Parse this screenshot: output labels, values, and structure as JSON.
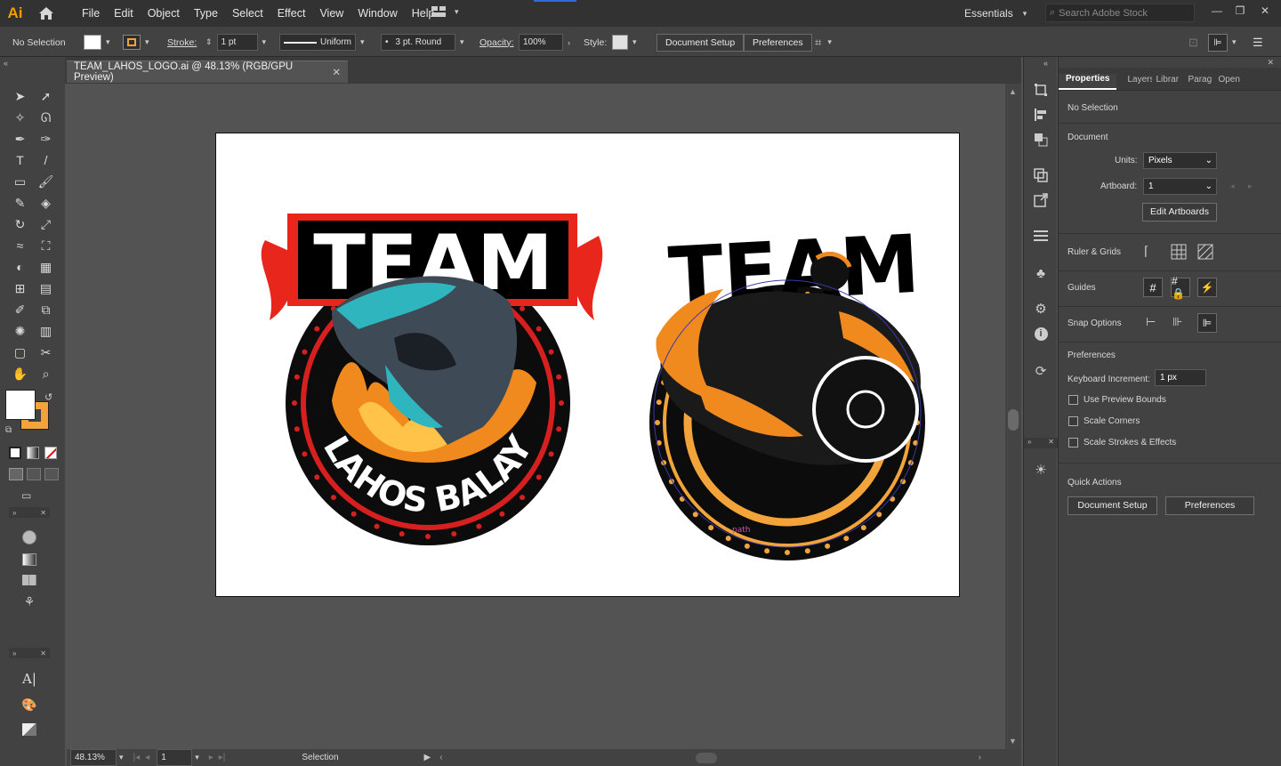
{
  "app": {
    "logo": "Ai",
    "menus": [
      "File",
      "Edit",
      "Object",
      "Type",
      "Select",
      "Effect",
      "View",
      "Window",
      "Help"
    ],
    "workspace": "Essentials",
    "search_placeholder": "Search Adobe Stock"
  },
  "control": {
    "selection": "No Selection",
    "stroke_label": "Stroke:",
    "stroke_weight": "1 pt",
    "profile": "Uniform",
    "brush": "3 pt. Round",
    "opacity_label": "Opacity:",
    "opacity": "100%",
    "style_label": "Style:",
    "doc_setup": "Document Setup",
    "preferences": "Preferences",
    "fill_color": "#ffffff",
    "stroke_color": "#f2a43a"
  },
  "document": {
    "tab": "TEAM_LAHOS_LOGO.ai @ 48.13% (RGB/GPU Preview)"
  },
  "artwork": {
    "logo1_title": "TEAM",
    "logo1_ring_text": "LAHOS BALAY",
    "logo2_title": "TEAM",
    "anchor_label": "path"
  },
  "status": {
    "zoom": "48.13%",
    "artboard": "1",
    "tool": "Selection"
  },
  "properties": {
    "tabs": [
      "Properties",
      "Layers",
      "Librar",
      "Parag",
      "Open"
    ],
    "selection": "No Selection",
    "document_heading": "Document",
    "units_label": "Units:",
    "units": "Pixels",
    "artboard_label": "Artboard:",
    "artboard": "1",
    "edit_artboards": "Edit Artboards",
    "ruler_grids": "Ruler & Grids",
    "guides": "Guides",
    "snap_options": "Snap Options",
    "preferences_heading": "Preferences",
    "keyboard_increment_label": "Keyboard Increment:",
    "keyboard_increment": "1 px",
    "use_preview_bounds": "Use Preview Bounds",
    "scale_corners": "Scale Corners",
    "scale_strokes": "Scale Strokes & Effects",
    "quick_actions": "Quick Actions",
    "qa_doc_setup": "Document Setup",
    "qa_preferences": "Preferences"
  }
}
